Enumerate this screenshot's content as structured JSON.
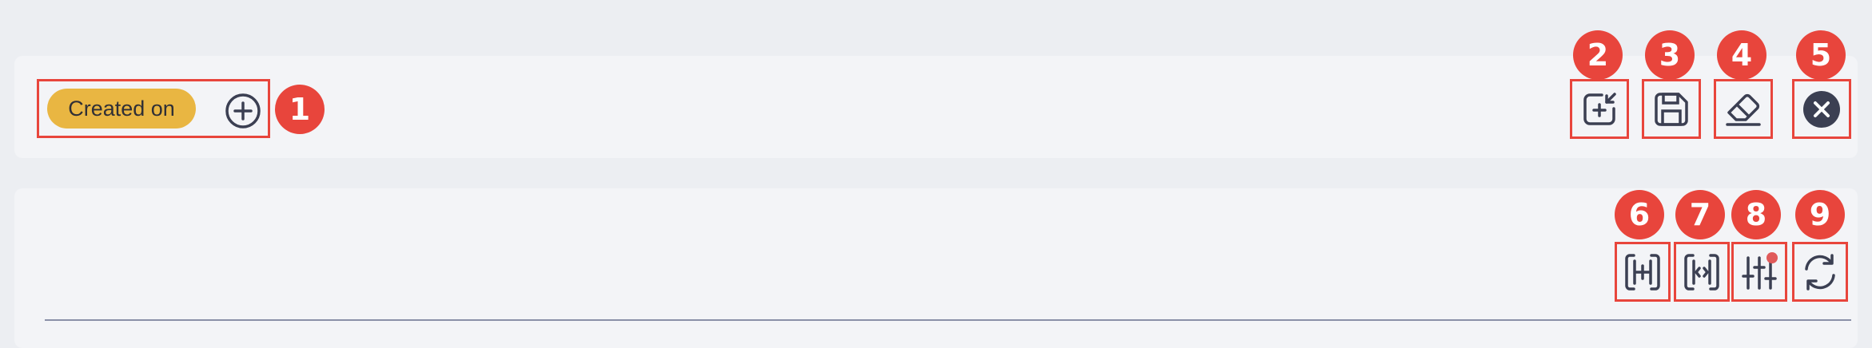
{
  "filter_bar": {
    "chip_label": "Created on",
    "add_filter_icon": "plus-circle-icon",
    "tools": [
      {
        "name": "add-filter-set",
        "icon": "add-to-box-icon"
      },
      {
        "name": "save",
        "icon": "floppy-disk-icon"
      },
      {
        "name": "clear",
        "icon": "eraser-icon"
      },
      {
        "name": "close",
        "icon": "close-circle-icon"
      }
    ]
  },
  "table_toolbar": {
    "tools": [
      {
        "name": "expand-columns",
        "icon": "expand-columns-icon"
      },
      {
        "name": "collapse-columns",
        "icon": "collapse-columns-icon"
      },
      {
        "name": "column-settings",
        "icon": "sliders-icon",
        "has_notification": true
      },
      {
        "name": "refresh",
        "icon": "refresh-icon"
      }
    ]
  },
  "callouts": [
    "1",
    "2",
    "3",
    "4",
    "5",
    "6",
    "7",
    "8",
    "9"
  ],
  "colors": {
    "chip": "#e9b642",
    "highlight": "#e8453c",
    "icon": "#3b3f52",
    "notification_dot": "#e05a5a"
  }
}
